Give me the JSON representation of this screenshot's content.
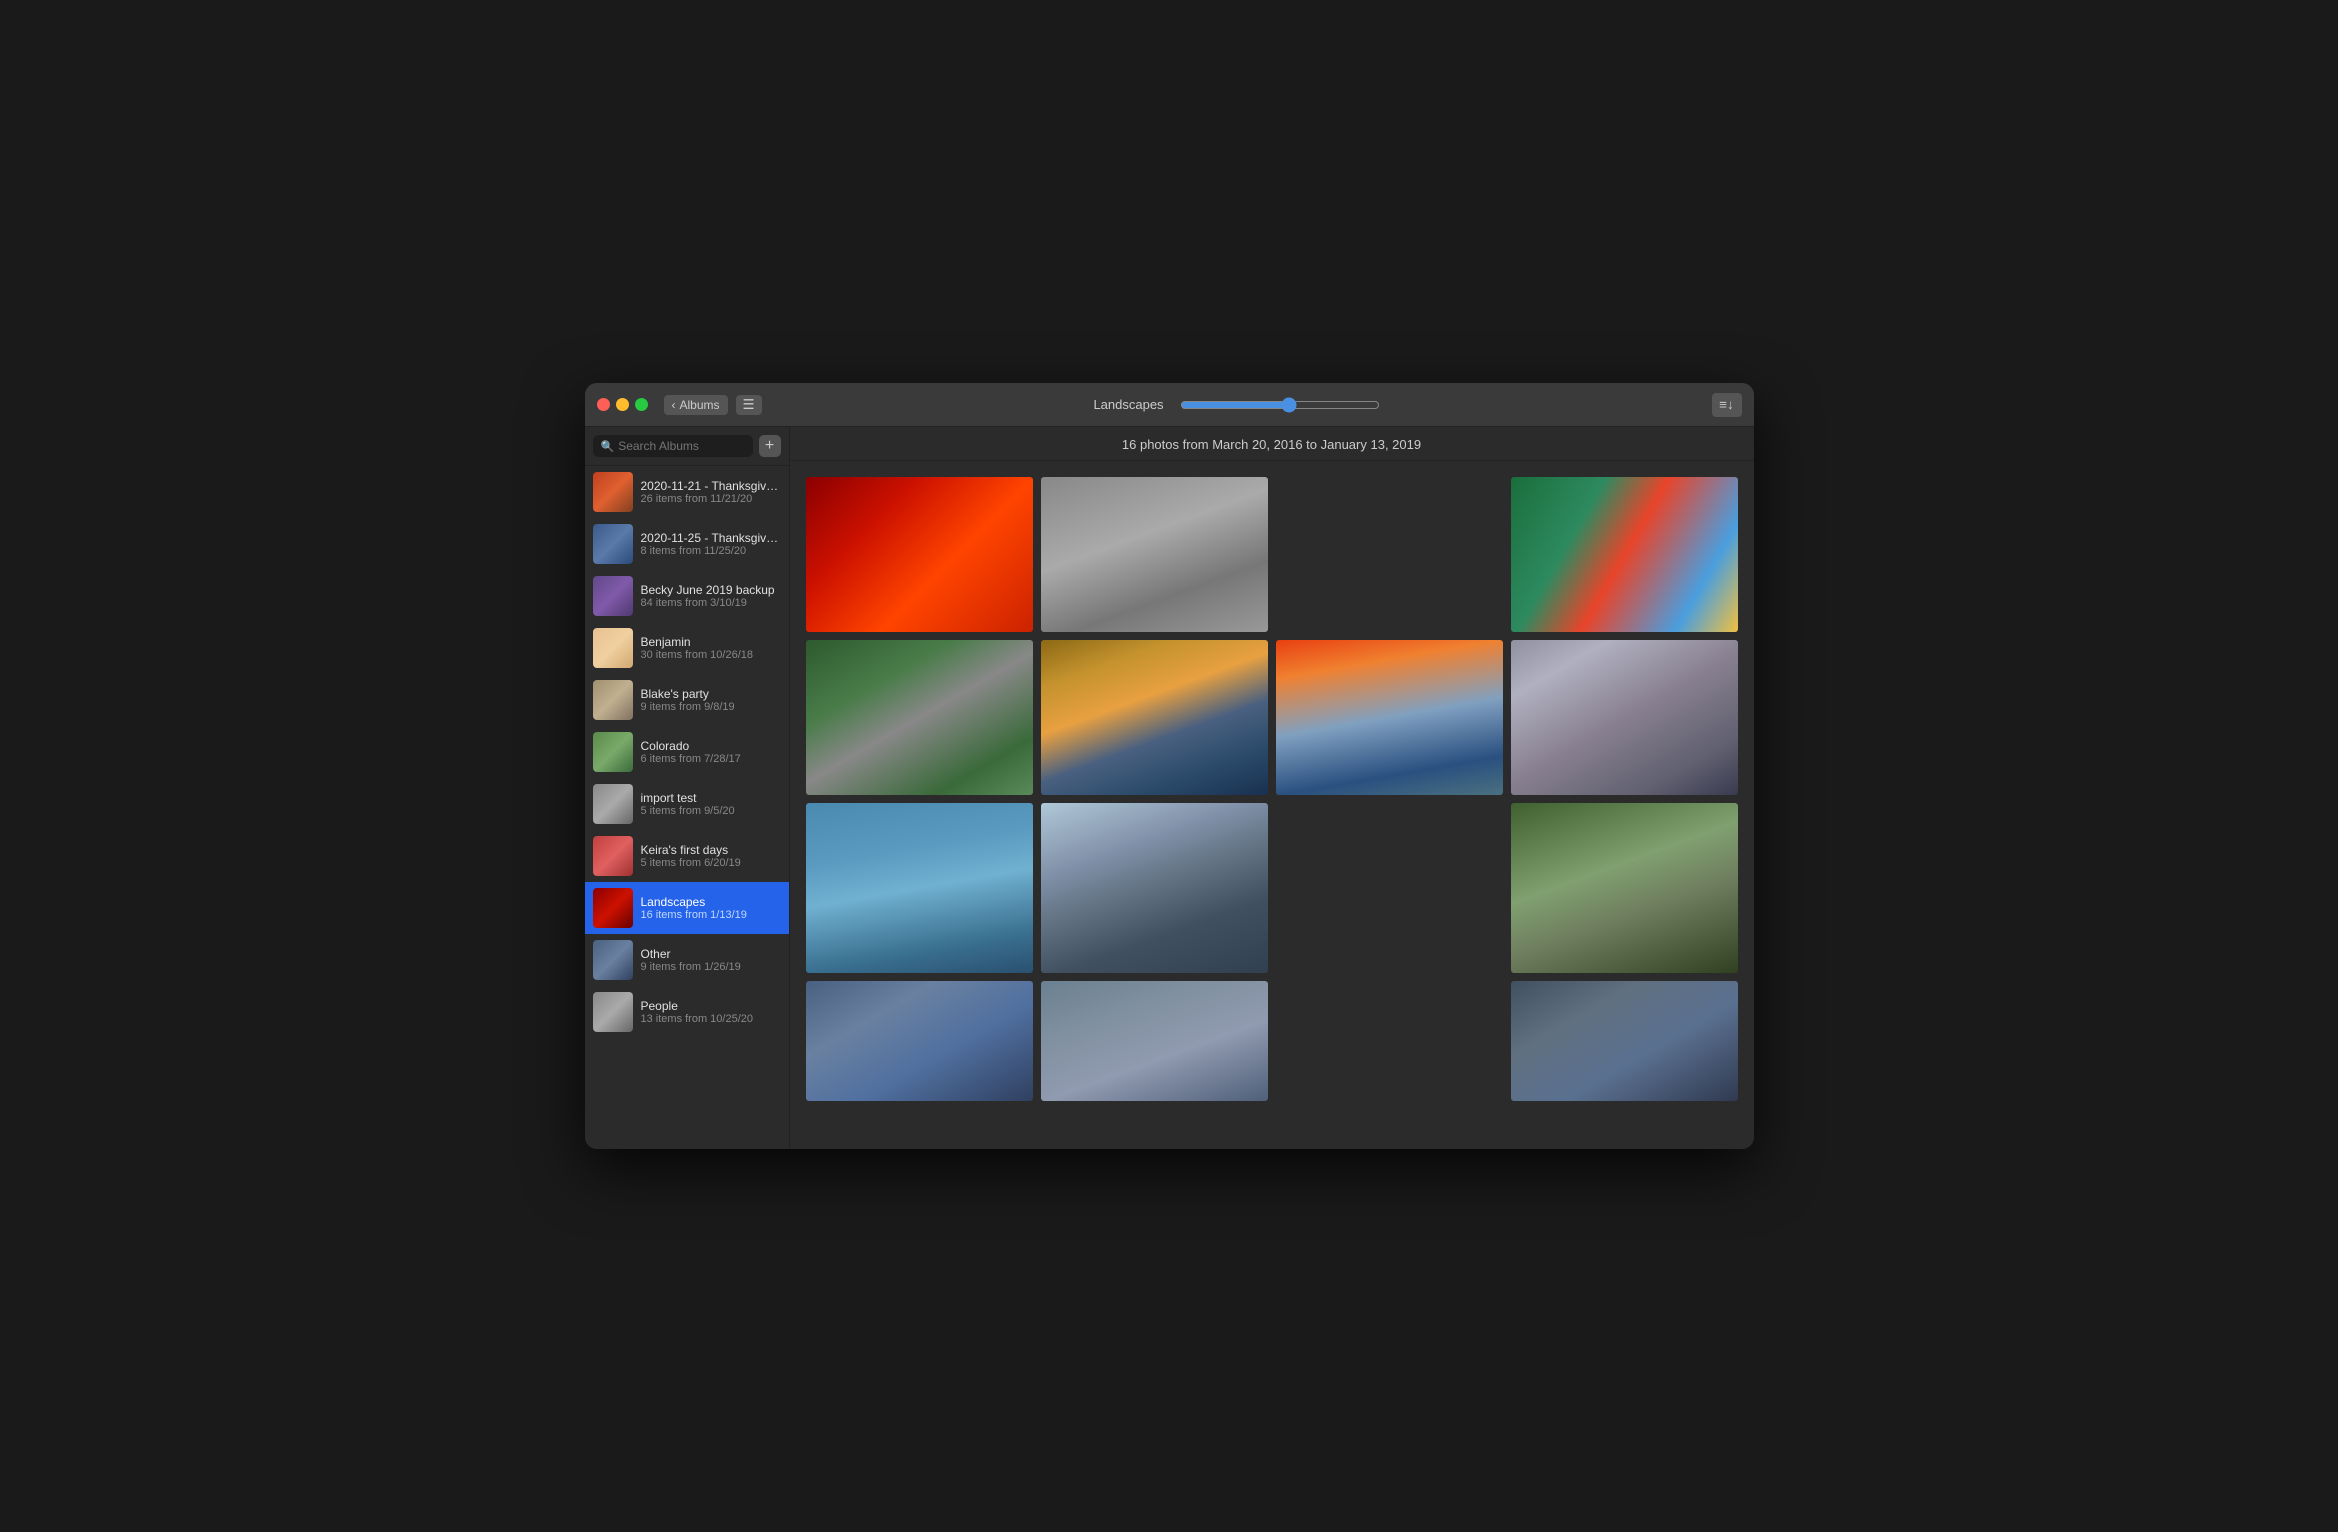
{
  "window": {
    "title": "Landscapes"
  },
  "titlebar": {
    "back_label": "Albums",
    "album_title": "Landscapes",
    "sort_icon": "≡↓"
  },
  "sidebar": {
    "search_placeholder": "Search Albums",
    "albums": [
      {
        "id": "thanksgiving1",
        "name": "2020-11-21 - Thanksgiving with...",
        "meta": "26 items from 11/21/20",
        "thumb_class": "thumb-thanksgiving1",
        "active": false
      },
      {
        "id": "thanksgiving2",
        "name": "2020-11-25 - Thanksgiving with...",
        "meta": "8 items from 11/25/20",
        "thumb_class": "thumb-thanksgiving2",
        "active": false
      },
      {
        "id": "becky",
        "name": "Becky June 2019 backup",
        "meta": "84 items from 3/10/19",
        "thumb_class": "thumb-becky",
        "active": false
      },
      {
        "id": "benjamin",
        "name": "Benjamin",
        "meta": "30 items from 10/26/18",
        "thumb_class": "thumb-benjamin",
        "active": false
      },
      {
        "id": "blake",
        "name": "Blake's party",
        "meta": "9 items from 9/8/19",
        "thumb_class": "thumb-blake",
        "active": false
      },
      {
        "id": "colorado",
        "name": "Colorado",
        "meta": "6 items from 7/28/17",
        "thumb_class": "thumb-colorado",
        "active": false
      },
      {
        "id": "import",
        "name": "import test",
        "meta": "5 items from 9/5/20",
        "thumb_class": "thumb-import",
        "active": false
      },
      {
        "id": "keira",
        "name": "Keira's first days",
        "meta": "5 items from 6/20/19",
        "thumb_class": "thumb-keira",
        "active": false
      },
      {
        "id": "landscapes",
        "name": "Landscapes",
        "meta": "16 items from 1/13/19",
        "thumb_class": "thumb-landscapes",
        "active": true
      },
      {
        "id": "other",
        "name": "Other",
        "meta": "9 items from 1/26/19",
        "thumb_class": "thumb-other",
        "active": false
      },
      {
        "id": "people",
        "name": "People",
        "meta": "13 items from 10/25/20",
        "thumb_class": "thumb-people",
        "active": false
      }
    ]
  },
  "main": {
    "header": "16 photos from March 20, 2016 to January 13, 2019"
  }
}
